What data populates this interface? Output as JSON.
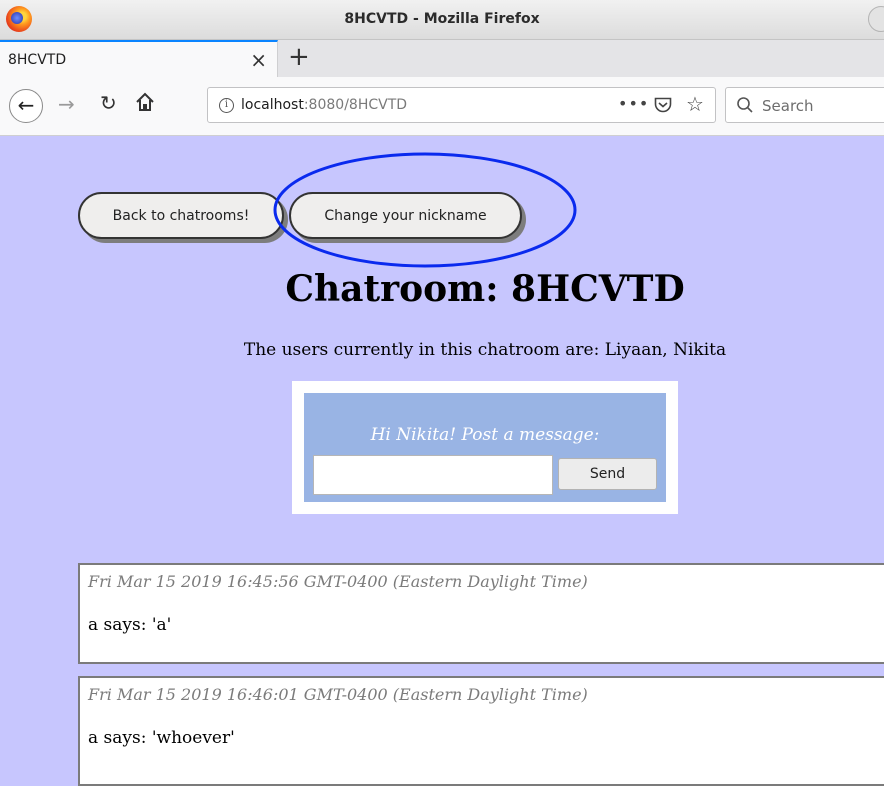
{
  "window": {
    "title": "8HCVTD - Mozilla Firefox"
  },
  "tabs": [
    {
      "label": "8HCVTD"
    }
  ],
  "navbar": {
    "url_host": "localhost",
    "url_rest": ":8080/8HCVTD",
    "search_placeholder": "Search"
  },
  "page": {
    "back_label": "Back to chatrooms!",
    "nickname_label": "Change your nickname",
    "title": "Chatroom: 8HCVTD",
    "users_text": "The users currently in this chatroom are: Liyaan, Nikita",
    "post_prompt": "Hi Nikita! Post a message:",
    "send_label": "Send",
    "annotation_color": "#0a2aee"
  },
  "messages": [
    {
      "time": "Fri Mar 15 2019 16:45:56 GMT-0400 (Eastern Daylight Time)",
      "text": "a says: 'a'"
    },
    {
      "time": "Fri Mar 15 2019 16:46:01 GMT-0400 (Eastern Daylight Time)",
      "text": "a says: 'whoever'"
    }
  ]
}
